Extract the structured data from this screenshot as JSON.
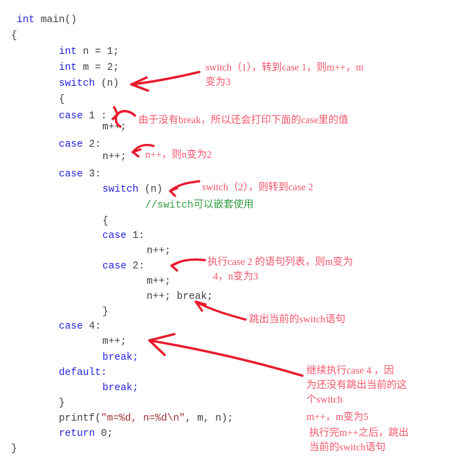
{
  "document": {
    "kind": "annotated-c-code-screenshot",
    "language": "C"
  },
  "colors": {
    "keyword": "#2222dd",
    "identifier": "#3d3d3d",
    "string": "#a03030",
    "comment": "#2f9c40",
    "annotation_text": "#f4556a",
    "annotation_ink": "#e8192c",
    "background": "#ffffff"
  },
  "code": {
    "lines": [
      {
        "id": "l01",
        "text": "int main()"
      },
      {
        "id": "l02",
        "text": "{"
      },
      {
        "id": "l03",
        "text": "int n = 1;"
      },
      {
        "id": "l04",
        "text": "int m = 2;"
      },
      {
        "id": "l05",
        "text": "switch (n)"
      },
      {
        "id": "l06",
        "text": "{"
      },
      {
        "id": "l07",
        "text": "case 1 :"
      },
      {
        "id": "l08",
        "text": "m++;"
      },
      {
        "id": "l09",
        "text": "case 2:"
      },
      {
        "id": "l10",
        "text": "n++;"
      },
      {
        "id": "l11",
        "text": "case 3:"
      },
      {
        "id": "l12",
        "text": "switch (n)"
      },
      {
        "id": "l13",
        "text": "//switch可以嵌套使用"
      },
      {
        "id": "l14",
        "text": "{"
      },
      {
        "id": "l15",
        "text": "case 1:"
      },
      {
        "id": "l16",
        "text": "n++;"
      },
      {
        "id": "l17",
        "text": "case 2:"
      },
      {
        "id": "l18",
        "text": "m++;"
      },
      {
        "id": "l19",
        "text": "n++; break;"
      },
      {
        "id": "l20",
        "text": "}"
      },
      {
        "id": "l21",
        "text": "case 4:"
      },
      {
        "id": "l22",
        "text": "m++;"
      },
      {
        "id": "l23",
        "text": "break;"
      },
      {
        "id": "l24",
        "text": "default:"
      },
      {
        "id": "l25",
        "text": "break;"
      },
      {
        "id": "l26",
        "text": "}"
      },
      {
        "id": "l27",
        "text": "printf(\"m=%d, n=%d\\n\", m, n);"
      },
      {
        "id": "l28",
        "text": "return 0;"
      },
      {
        "id": "l29",
        "text": "}"
      }
    ],
    "tokens": {
      "kw_int": "int",
      "kw_switch": "switch",
      "kw_case": "case",
      "kw_break": "break",
      "kw_default": "default",
      "kw_return": "return",
      "fn_main": "main()",
      "decl_n": " n = 1;",
      "decl_m": " m = 2;",
      "arg_n": " (n)",
      "brace_open": "{",
      "brace_close": "}",
      "case1_label": " 1 :",
      "case2_label": " 2:",
      "case3_label": " 3:",
      "case4_label": " 4:",
      "nested_case1_label": " 1:",
      "nested_case2_label": " 2:",
      "stmt_m_inc": "m++;",
      "stmt_n_inc": "n++;",
      "stmt_n_inc_break": "n++; break;",
      "stmt_break": "break;",
      "label_default": "default:",
      "printf_name": "printf(",
      "printf_string": "\"m=%d, n=%d\\n\"",
      "printf_args": ", m, n);",
      "return_value": " 0;",
      "nested_comment": "//switch可以嵌套使用"
    }
  },
  "annotations": [
    {
      "id": "a1",
      "name": "note-switch-1-to-case-1",
      "lines": [
        "switch（1），转到case 1，则m++，m",
        "变为3"
      ]
    },
    {
      "id": "a2",
      "name": "note-no-break-falls-through",
      "lines": [
        "由于没有break，所以还会打印下面的case里的值"
      ]
    },
    {
      "id": "a3",
      "name": "note-n-becomes-2",
      "lines": [
        "n++，则n变为2"
      ]
    },
    {
      "id": "a4",
      "name": "note-switch-2-to-case-2",
      "lines": [
        "switch（2），则转到case 2"
      ]
    },
    {
      "id": "a5",
      "name": "note-execute-case-2-body",
      "lines": [
        "执行case 2 的语句列表，则m变为",
        "4，n变为3"
      ]
    },
    {
      "id": "a6",
      "name": "note-break-exits-switch",
      "lines": [
        "跳出当前的switch语句"
      ]
    },
    {
      "id": "a7",
      "name": "note-continue-case-4",
      "lines": [
        "继续执行case 4 ，因",
        "为还没有跳出当前的这",
        "个switch"
      ]
    },
    {
      "id": "a8",
      "name": "note-m-becomes-5",
      "lines": [
        "m++，m变为5"
      ]
    },
    {
      "id": "a9",
      "name": "note-after-m-inc-exit-switch",
      "lines": [
        "执行完m++之后，跳出",
        "当前的switch语句"
      ]
    }
  ]
}
